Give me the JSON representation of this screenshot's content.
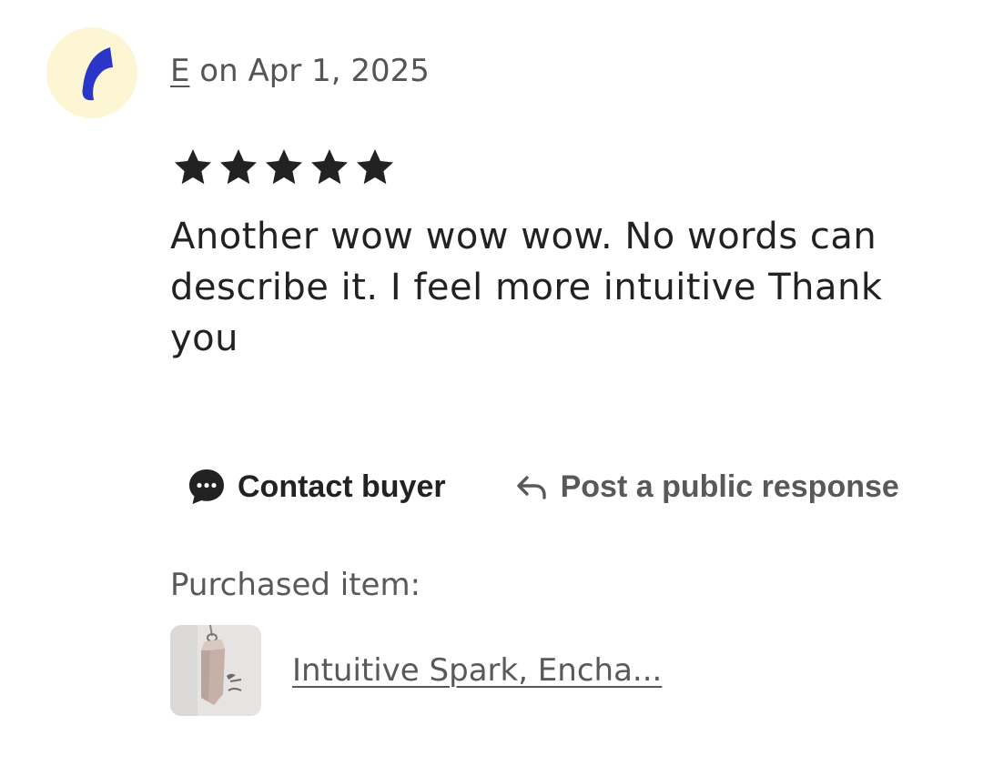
{
  "review": {
    "avatar": {
      "icon": "reviewer-avatar-crescent",
      "background_color": "#fdf6d4",
      "mark_color": "#2b35c8"
    },
    "reviewer_name": "E",
    "date_text": " on Apr 1, 2025",
    "rating": 5,
    "rating_max": 5,
    "star_icon": "filled-star-icon",
    "text": "Another wow wow wow. No words can describe it. I feel more intuitive Thank you"
  },
  "actions": {
    "contact_buyer": {
      "label": "Contact buyer",
      "icon": "chat-bubble-icon"
    },
    "public_response": {
      "label": "Post a public response",
      "icon": "reply-arrow-icon"
    }
  },
  "purchase": {
    "label": "Purchased item:",
    "item_title": "Intuitive Spark, Encha...",
    "thumbnail": "crystal-pendant-thumbnail"
  }
}
